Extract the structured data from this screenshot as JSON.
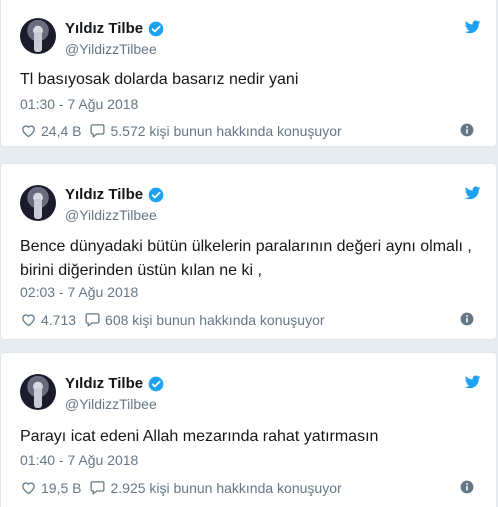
{
  "colors": {
    "twitter_blue": "#1da1f2",
    "muted": "#657786",
    "text": "#14171a",
    "background": "#e6ecf0"
  },
  "icons": {
    "verified": "verified-badge-icon",
    "bird": "twitter-bird-icon",
    "like": "heart-icon",
    "reply": "speech-bubble-icon",
    "info": "info-icon"
  },
  "tweets": [
    {
      "display_name": "Yıldız Tilbe",
      "handle": "@YildizzTilbee",
      "text": "Tl basıyosak dolarda basarız nedir yani",
      "timestamp": "01:30 - 7 Ağu 2018",
      "likes": "24,4 B",
      "replies": "5.572 kişi bunun hakkında konuşuyor"
    },
    {
      "display_name": "Yıldız Tilbe",
      "handle": "@YildizzTilbee",
      "text": "Bence dünyadaki bütün ülkelerin paralarının  değeri aynı olmalı , birini diğerinden üstün kılan ne ki ,",
      "timestamp": "02:03 - 7 Ağu 2018",
      "likes": "4.713",
      "replies": "608 kişi bunun hakkında konuşuyor"
    },
    {
      "display_name": "Yıldız Tilbe",
      "handle": "@YildizzTilbee",
      "text": "Parayı icat edeni Allah mezarında rahat yatırmasın",
      "timestamp": "01:40 - 7 Ağu 2018",
      "likes": "19,5 B",
      "replies": "2.925 kişi bunun hakkında konuşuyor"
    }
  ]
}
